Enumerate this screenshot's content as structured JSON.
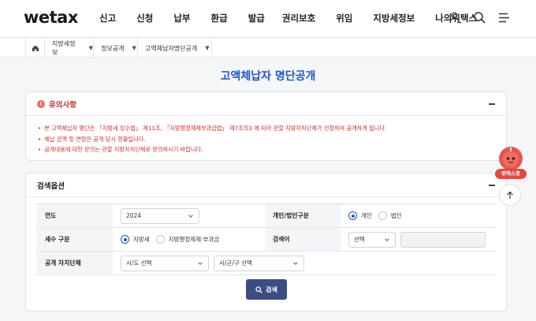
{
  "header": {
    "logo": "wetax",
    "nav": [
      "신고",
      "신청",
      "납부",
      "환급",
      "발급",
      "권리보호",
      "위임",
      "지방세정보",
      "나의위택스"
    ],
    "icons": [
      "user-icon",
      "search-icon",
      "menu-icon"
    ]
  },
  "breadcrumb": {
    "home_icon": "home-icon",
    "items": [
      "지방세정보",
      "정보공개",
      "고액체납자명단공개"
    ]
  },
  "page_title": "고액체납자 명단공개",
  "notice": {
    "title": "유의사항",
    "items": [
      "본 고액체납자 명단은 「지방세 징수법」 제11조, 「지방행정제재부과금법」 제7조의3 에 따라 관할 지방자치단체가 선정하여 공개하게 됩니다.",
      "체납 금액 및 연령은 공개 당시 현황입니다.",
      "공개내용에 대한 문의는 관할 지방자치단체로 문의하시기 바랍니다."
    ]
  },
  "search": {
    "title": "검색옵션",
    "year_label": "연도",
    "year_value": "2024",
    "person_type_label": "개인/법인구분",
    "person_options": [
      "개인",
      "법인"
    ],
    "person_selected": "개인",
    "tax_type_label": "세수 구분",
    "tax_options": [
      "지방세",
      "지방행정제재·부과금"
    ],
    "tax_selected": "지방세",
    "keyword_label": "검색어",
    "keyword_select": "선택",
    "keyword_value": "",
    "region_label": "공개 자치단체",
    "sido_select": "시/도 선택",
    "sigungu_select": "시/군/구 선택",
    "button": "검색"
  },
  "floating": {
    "chatbot_label": "위택스봇",
    "top_icon": "arrow-up-icon"
  },
  "colors": {
    "accent": "#1f55c8",
    "warning": "#d52b2b",
    "button": "#3c4d82",
    "chatbot": "#e04a3f"
  }
}
